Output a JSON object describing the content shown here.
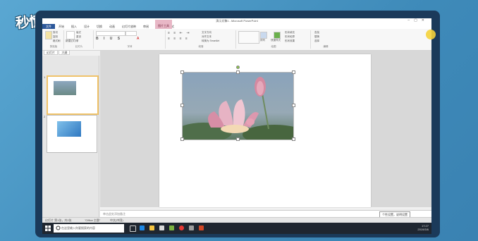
{
  "watermark": "秒懂视频",
  "window": {
    "title": "演示文稿1 - Microsoft PowerPoint"
  },
  "ribbon": {
    "tabs": [
      "文件",
      "开始",
      "插入",
      "设计",
      "切换",
      "动画",
      "幻灯片放映",
      "审阅",
      "视图",
      "格式"
    ],
    "context_tab": "图片工具",
    "groups": [
      "剪贴板",
      "幻灯片",
      "字体",
      "段落",
      "绘图",
      "编辑"
    ],
    "clipboard_buttons": [
      "剪切",
      "复制",
      "格式刷"
    ],
    "slide_buttons": [
      "新建幻灯片",
      "版式",
      "重设",
      "节"
    ],
    "paragraph_buttons": [
      "文字方向",
      "对齐文本",
      "转换为 SmartArt"
    ],
    "draw_buttons": [
      "排列",
      "快速样式"
    ],
    "shape_buttons": [
      "形状填充",
      "形状轮廓",
      "形状效果"
    ],
    "edit_buttons": [
      "查找",
      "替换",
      "选择"
    ]
  },
  "pane": {
    "tabs": [
      "幻灯片",
      "大纲"
    ],
    "slides": [
      {
        "num": "1"
      },
      {
        "num": "2"
      }
    ]
  },
  "notes": {
    "placeholder": "单击此处添加备注"
  },
  "status": {
    "slide": "幻灯片 第1张，共2张",
    "theme": "\"Office 主题\"",
    "lang": "中文(中国)"
  },
  "tooltip": "个性设置，说明设置",
  "taskbar": {
    "search": "在这里输入你要搜索的内容",
    "time": "17:27",
    "date": "2019/3/6"
  }
}
